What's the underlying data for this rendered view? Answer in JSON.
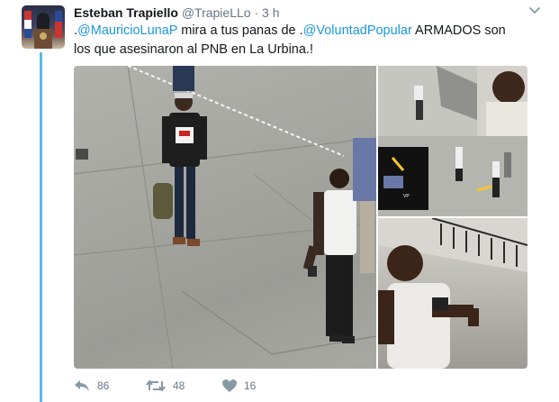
{
  "tweet": {
    "author_name": "Esteban Trapiello",
    "author_handle": "@TrapieLLo",
    "separator": "·",
    "timestamp": "3 h",
    "text_prefix": ".",
    "mention_1": "@MauricioLunaP",
    "text_mid": " mira a tus panas de .",
    "mention_2": "@VoluntadPopular",
    "text_rest": " ARMADOS son los que asesinaron al PNB en La Urbina.!",
    "image_caption": "VP"
  },
  "actions": {
    "reply_count": "86",
    "retweet_count": "48",
    "like_count": "16"
  },
  "colors": {
    "link": "#1b95e0",
    "thread_line": "#5ebae7",
    "muted": "#657786"
  },
  "icons": [
    "caret-down-icon",
    "reply-icon",
    "retweet-icon",
    "like-icon"
  ]
}
